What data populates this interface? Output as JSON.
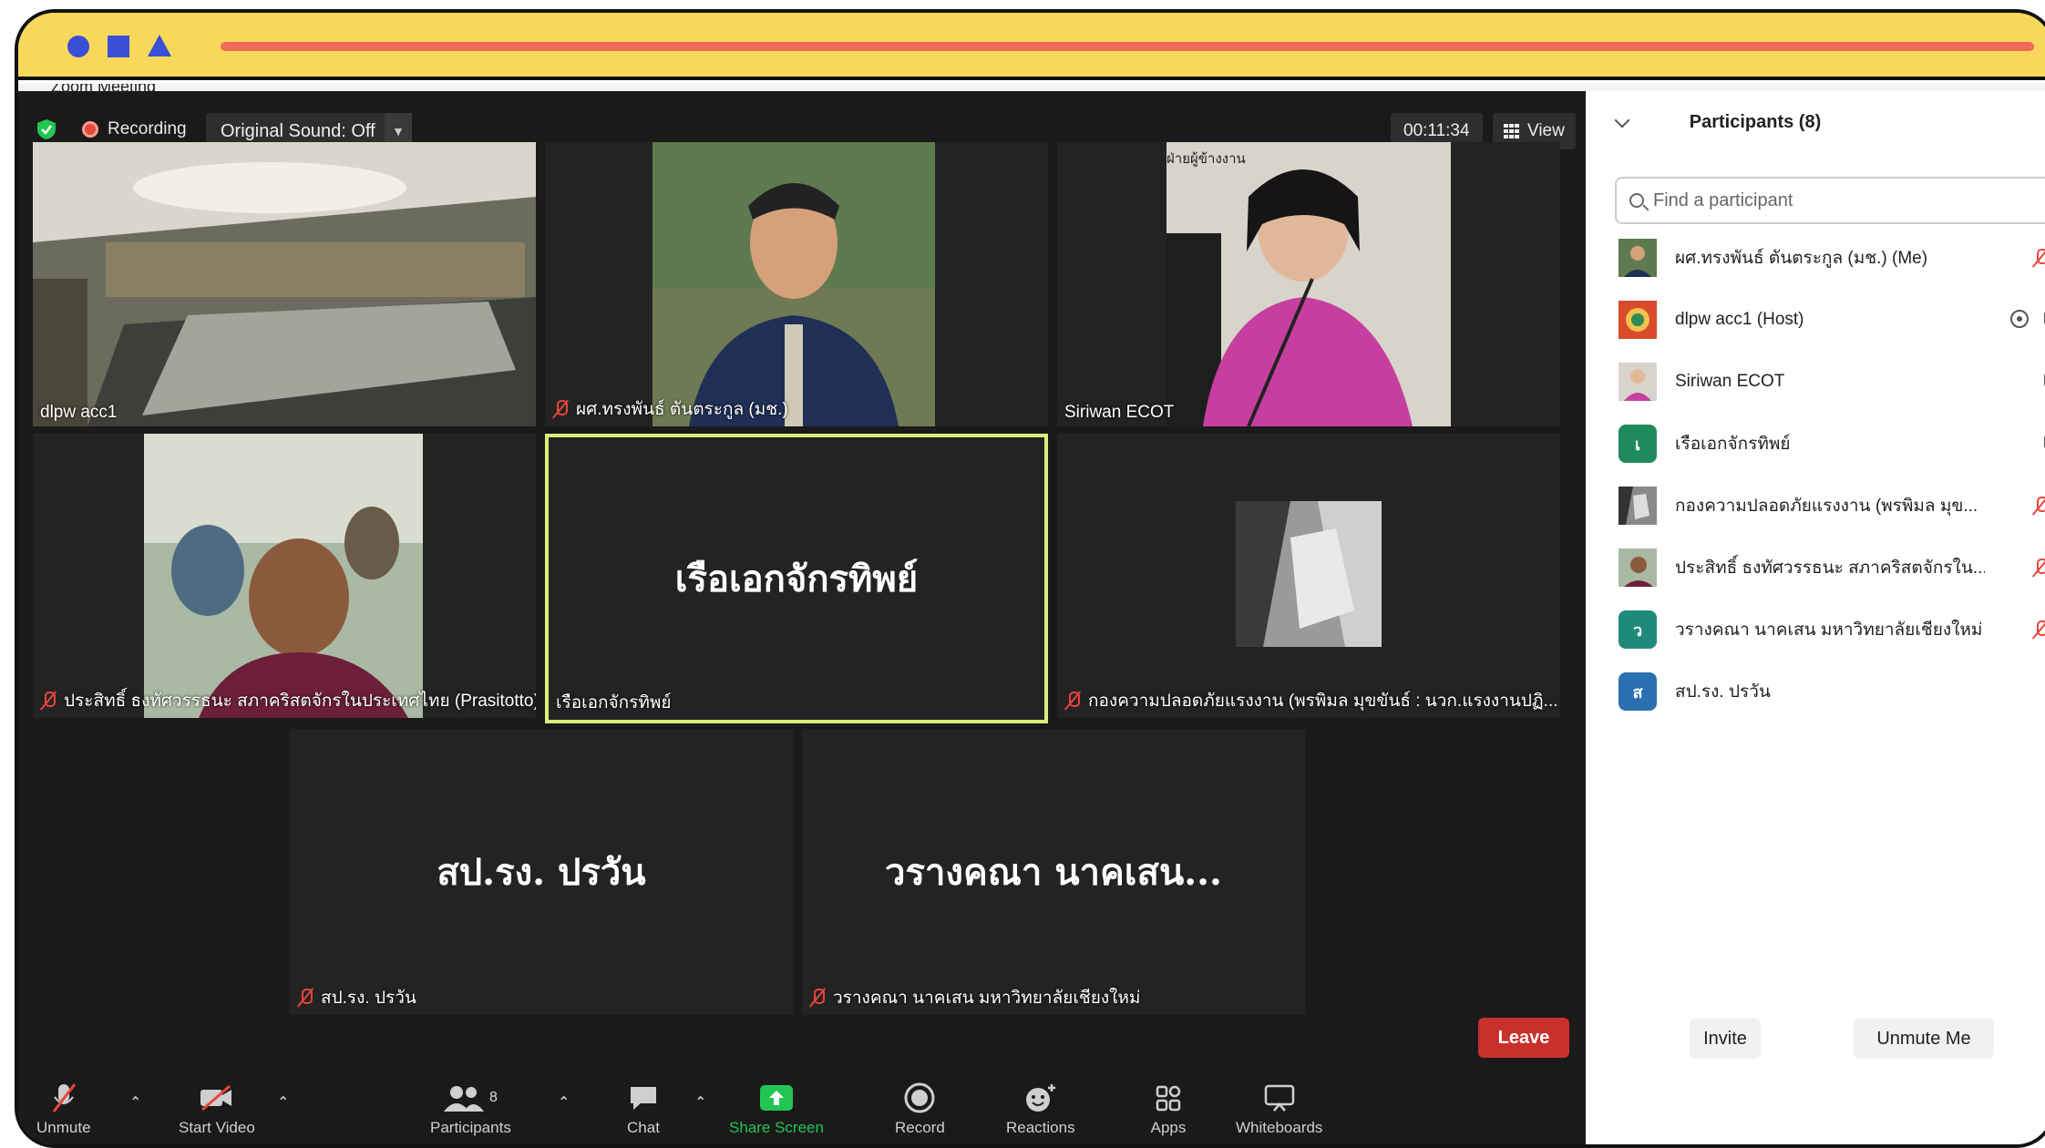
{
  "window": {
    "title": "Zoom Meeting"
  },
  "topbar": {
    "recording_label": "Recording",
    "original_sound": "Original Sound: Off",
    "timer": "00:11:34",
    "view_label": "View"
  },
  "tiles": [
    {
      "name": "dlpw acc1"
    },
    {
      "name": "ผศ.ทรงพันธ์ ตันตระกูล (มช.)"
    },
    {
      "name": "Siriwan ECOT",
      "overlay": "ฝ่ายผู้ข้างงาน"
    },
    {
      "name": "ประสิทธิ์ ธงทัศวรรธนะ สภาคริสตจักรในประเทศไทย (Prasitotto)"
    },
    {
      "name": "เรือเอกจักรทิพย์",
      "big": "เรือเอกจักรทิพย์"
    },
    {
      "name": "กองความปลอดภัยแรงงาน (พรพิมล มุขขันธ์ : นวก.แรงงานปฏิ..."
    },
    {
      "name": "สป.รง. ปรวัน",
      "big": "สป.รง. ปรวัน"
    },
    {
      "name": "วรางคณา นาคเสน มหาวิทยาลัยเชียงใหม่",
      "big": "วรางคณา นาคเสน..."
    }
  ],
  "toolbar": {
    "unmute": "Unmute",
    "start_video": "Start Video",
    "participants": "Participants",
    "participants_count": "8",
    "chat": "Chat",
    "share_screen": "Share Screen",
    "record": "Record",
    "reactions": "Reactions",
    "apps": "Apps",
    "whiteboards": "Whiteboards",
    "leave": "Leave"
  },
  "panel": {
    "title": "Participants (8)",
    "search_placeholder": "Find a participant",
    "participants": [
      {
        "name": "ผศ.ทรงพันธ์ ตันตระกูล (มช.) (Me)",
        "mic": "off",
        "cam": "off"
      },
      {
        "name": "dlpw acc1 (Host)",
        "mic": "on",
        "cam": "on",
        "recording": true
      },
      {
        "name": "Siriwan ECOT",
        "mic": "on",
        "cam": "off"
      },
      {
        "name": "เรือเอกจักรทิพย์",
        "initial": "เ",
        "mic": "on",
        "cam": "off"
      },
      {
        "name": "กองความปลอดภัยแรงงาน (พรพิมล มุข...",
        "mic": "off",
        "cam": "off"
      },
      {
        "name": "ประสิทธิ์ ธงทัศวรรธนะ สภาคริสตจักรใน...",
        "mic": "off",
        "cam": "off"
      },
      {
        "name": "วรางคณา นาคเสน มหาวิทยาลัยเชียงใหม่",
        "initial": "ว",
        "mic": "off",
        "cam": "off"
      },
      {
        "name": "สป.รง. ปรวัน",
        "initial": "ส",
        "mic": "off"
      }
    ],
    "invite": "Invite",
    "unmute_me": "Unmute Me"
  },
  "colors": {
    "accent_green": "#23c552",
    "leave_red": "#c9302c",
    "active_speaker": "#d8ef7a",
    "chrome_yellow": "#f8d85a"
  }
}
